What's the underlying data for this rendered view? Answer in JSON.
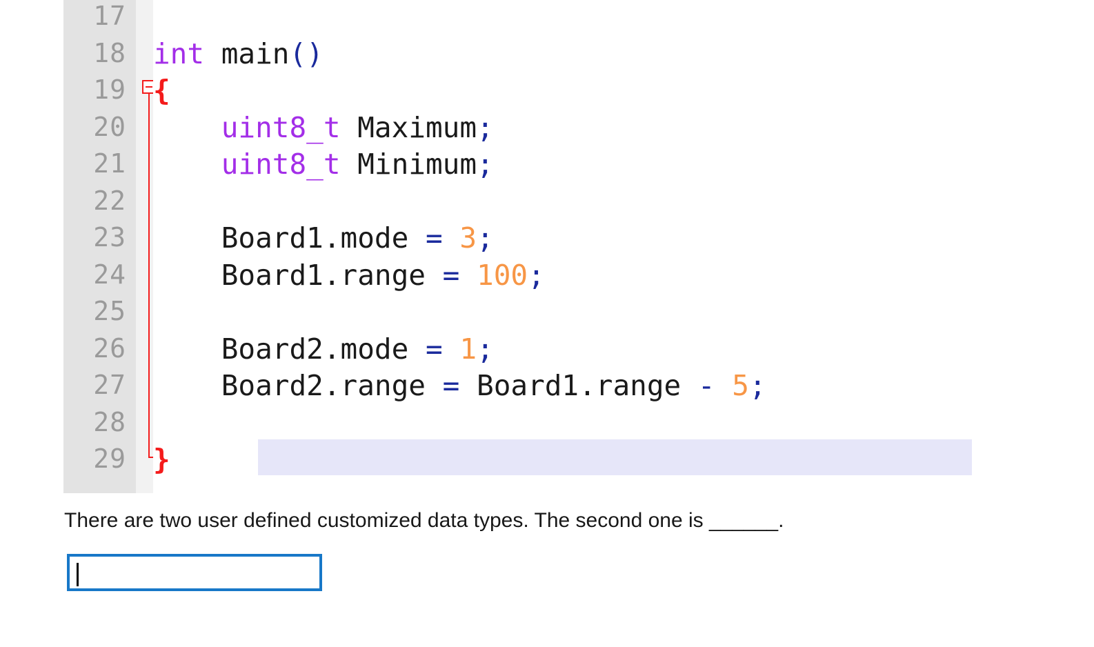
{
  "code_block": {
    "language": "c",
    "first_visible_line": 17,
    "colors": {
      "gutter_background": "#e3e3e3",
      "gutter_strip": "#f2f2f2",
      "line_number": "#9a9a9a",
      "keyword": "#a32ee8",
      "identifier": "#1a1a1a",
      "punctuation": "#1a2a9c",
      "number": "#f79646",
      "brace": "#f41b1b",
      "fold_marker": "#f41b1b",
      "current_line_highlight": "#e6e6f9",
      "background": "#ffffff"
    },
    "fold_marker": {
      "line": 19,
      "state": "expanded",
      "glyph": "minus"
    },
    "current_line": 29,
    "lines": [
      {
        "number": "17",
        "tokens": []
      },
      {
        "number": "18",
        "tokens": [
          {
            "text": "int",
            "type": "keyword"
          },
          {
            "text": " main",
            "type": "identifier"
          },
          {
            "text": "()",
            "type": "punctuation"
          }
        ]
      },
      {
        "number": "19",
        "tokens": [
          {
            "text": "{",
            "type": "brace"
          }
        ]
      },
      {
        "number": "20",
        "tokens": [
          {
            "text": "    ",
            "type": "identifier"
          },
          {
            "text": "uint8_t",
            "type": "keyword"
          },
          {
            "text": " Maximum",
            "type": "identifier"
          },
          {
            "text": ";",
            "type": "punctuation"
          }
        ]
      },
      {
        "number": "21",
        "tokens": [
          {
            "text": "    ",
            "type": "identifier"
          },
          {
            "text": "uint8_t",
            "type": "keyword"
          },
          {
            "text": " Minimum",
            "type": "identifier"
          },
          {
            "text": ";",
            "type": "punctuation"
          }
        ]
      },
      {
        "number": "22",
        "tokens": []
      },
      {
        "number": "23",
        "tokens": [
          {
            "text": "    Board1.mode ",
            "type": "identifier"
          },
          {
            "text": "= ",
            "type": "punctuation"
          },
          {
            "text": "3",
            "type": "number"
          },
          {
            "text": ";",
            "type": "punctuation"
          }
        ]
      },
      {
        "number": "24",
        "tokens": [
          {
            "text": "    Board1.range ",
            "type": "identifier"
          },
          {
            "text": "= ",
            "type": "punctuation"
          },
          {
            "text": "100",
            "type": "number"
          },
          {
            "text": ";",
            "type": "punctuation"
          }
        ]
      },
      {
        "number": "25",
        "tokens": []
      },
      {
        "number": "26",
        "tokens": [
          {
            "text": "    Board2.mode ",
            "type": "identifier"
          },
          {
            "text": "= ",
            "type": "punctuation"
          },
          {
            "text": "1",
            "type": "number"
          },
          {
            "text": ";",
            "type": "punctuation"
          }
        ]
      },
      {
        "number": "27",
        "tokens": [
          {
            "text": "    Board2.range ",
            "type": "identifier"
          },
          {
            "text": "= ",
            "type": "punctuation"
          },
          {
            "text": "Board1.range ",
            "type": "identifier"
          },
          {
            "text": "- ",
            "type": "punctuation"
          },
          {
            "text": "5",
            "type": "number"
          },
          {
            "text": ";",
            "type": "punctuation"
          }
        ]
      },
      {
        "number": "28",
        "tokens": []
      },
      {
        "number": "29",
        "tokens": [
          {
            "text": "}",
            "type": "brace"
          }
        ]
      }
    ]
  },
  "question": {
    "text": "There are two user defined customized data types. The second one is ______."
  },
  "answer": {
    "value": "",
    "placeholder": "",
    "focused": true,
    "border_color": "#1878c8"
  }
}
